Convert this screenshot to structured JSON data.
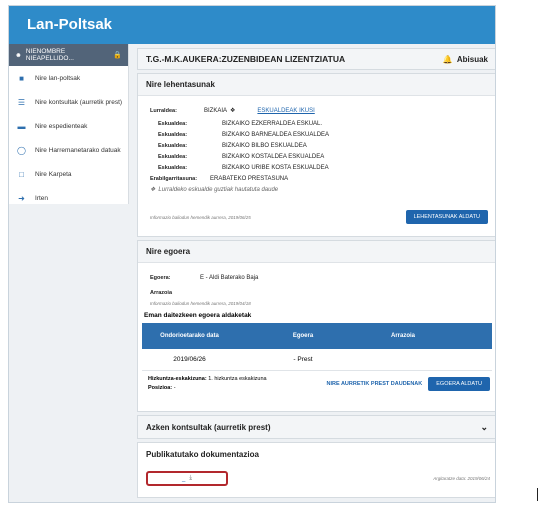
{
  "app": {
    "title": "Lan-Poltsak"
  },
  "sidebar": {
    "user": "NIENOMBRE NIEAPELLIDO...",
    "items": [
      {
        "label": "Nire lan-poltsak",
        "icon": "briefcase-icon"
      },
      {
        "label": "Nire kontsultak (aurretik prest)",
        "icon": "list-icon"
      },
      {
        "label": "Nire espedienteak",
        "icon": "folder-icon"
      },
      {
        "label": "Nire Harremanetarako datuak",
        "icon": "user-icon"
      },
      {
        "label": "Nire Karpeta",
        "icon": "folder-open-icon"
      },
      {
        "label": "Irten",
        "icon": "sign-out-icon"
      }
    ]
  },
  "topbar": {
    "title": "T.G.-M.K.AUKERA:ZUZENBIDEAN LIZENTZIATUA",
    "alerts": "Abisuak"
  },
  "prefs": {
    "title": "Nire lehentasunak",
    "lurraldea_label": "Lurraldea:",
    "lurraldea_value": "BIZKAIA",
    "eskualdeak_link": "ESKUALDEAK IKUSI",
    "eskualdea_label": "Eskualdea:",
    "eskualdeak": [
      "BIZKAIKO EZKERRALDEA ESKUAL.",
      "BIZKAIKO BARNEALDEA ESKUALDEA",
      "BIZKAIKO BILBO ESKUALDEA",
      "BIZKAIKO KOSTALDEA ESKUALDEA",
      "BIZKAIKO URIBE KOSTA ESKUALDEA"
    ],
    "erabilgarritasuna_label": "Erabilgarritasuna:",
    "erabilgarritasuna_value": "ERABATEKO PRESTASUNA",
    "note": "Lurraldeko eskualde guztiak hautatuta daude",
    "info": "Informazio baliodun hemendik aurrera, 2019/06/25",
    "button": "LEHENTASUNAK ALDATU"
  },
  "state": {
    "title": "Nire egoera",
    "egoera_label": "Egoera:",
    "egoera_value": "E - Aldi Baterako Baja",
    "arrazoia_label": "Arrazoia",
    "info": "Informazio baliodun hemendik aurrera, 2019/04/18",
    "changes_title": "Eman daitezkeen egoera aldaketak",
    "columns": [
      "Ondorioetarako data",
      "Egoera",
      "Arrazoia"
    ],
    "rows": [
      {
        "date": "2019/06/26",
        "egoera": "- Prest",
        "arrazoia": ""
      }
    ],
    "hizkuntza_label": "Hizkuntza-eskakizuna:",
    "hizkuntza_value": "1. hizkuntza eskakizuna",
    "posizioa_label": "Posizioa:",
    "posizioa_value": "-",
    "prest_link": "NIRE AURRETIK PREST DAUDENAK",
    "button": "EGOERA ALDATU"
  },
  "queries": {
    "title": "Azken kontsultak (aurretik prest)"
  },
  "docs": {
    "title": "Publikatutako dokumentazioa",
    "file_label": "_",
    "date": "Argitaratze data: 2019/06/24"
  }
}
